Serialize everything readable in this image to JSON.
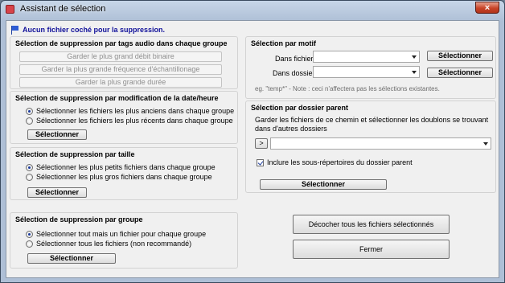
{
  "window": {
    "title": "Assistant de sélection",
    "close_glyph": "×"
  },
  "notice": "Aucun fichier coché pour la suppression.",
  "tags_group": {
    "title": "Sélection de suppression par tags audio dans chaque groupe",
    "buttons": [
      "Garder le plus grand débit binaire",
      "Garder la plus grande fréquence d'échantillonage",
      "Garder la plus grande durée"
    ]
  },
  "date_group": {
    "title": "Sélection de suppression par modification de la date/heure",
    "options": [
      "Sélectionner les fichiers les plus anciens dans chaque groupe",
      "Sélectionner les fichiers les plus récents dans chaque groupe"
    ],
    "button": "Sélectionner"
  },
  "size_group": {
    "title": "Sélection de suppression par taille",
    "options": [
      "Sélectionner les plus petits fichiers dans chaque groupe",
      "Sélectionner les plus gros fichiers dans chaque groupe"
    ],
    "button": "Sélectionner"
  },
  "group_group": {
    "title": "Sélection de suppression par groupe",
    "options": [
      "Sélectionner tout mais un fichier pour chaque groupe",
      "Sélectionner tous les fichiers (non recommandé)"
    ],
    "button": "Sélectionner"
  },
  "motif_group": {
    "title": "Sélection par motif",
    "file_label": "Dans fichier",
    "file_value": "",
    "folder_label": "Dans dossier",
    "folder_value": "",
    "select_label": "Sélectionner",
    "hint": "eg. \"temp*\" - Note : ceci n'affectera pas les sélections existantes."
  },
  "parent_group": {
    "title": "Sélection par dossier parent",
    "description": "Garder les fichiers de ce chemin et sélectionner les doublons se trouvant dans d'autres dossiers",
    "browse_label": ">",
    "path_value": "",
    "include_sub_label": "Inclure les sous-répertoires du dossier parent",
    "include_sub_checked": true,
    "button": "Sélectionner"
  },
  "actions": {
    "uncheck_all": "Décocher tous les fichiers sélectionnés",
    "close": "Fermer"
  }
}
